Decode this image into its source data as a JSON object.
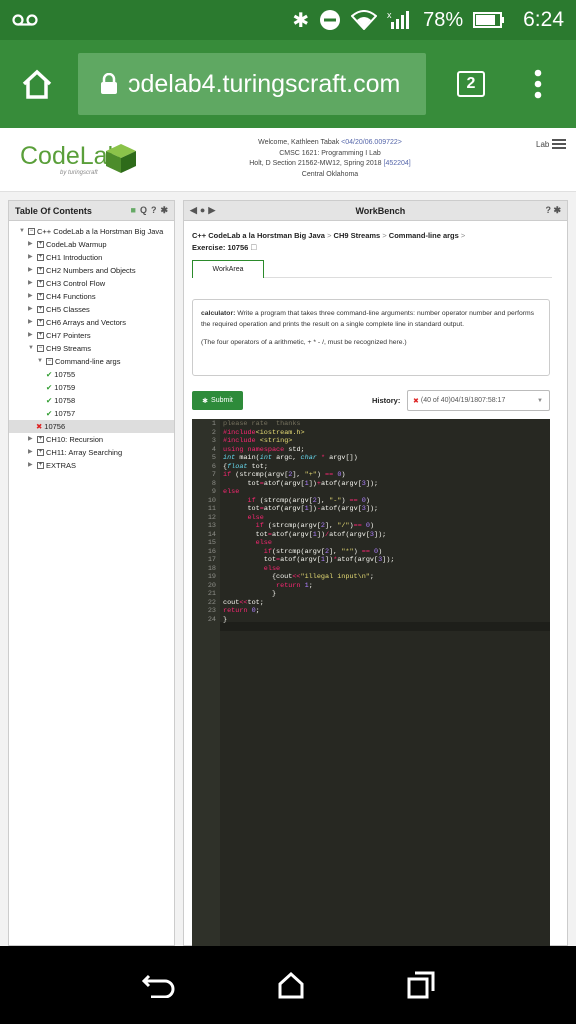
{
  "status": {
    "battery": "78%",
    "time": "6:24"
  },
  "browser": {
    "url": "ɔdelab4.turingscraft.com",
    "tabs": "2"
  },
  "header": {
    "logo": "CodeLab",
    "logo_sub": "by turingscraft",
    "welcome_line1_pre": "Welcome, Kathleen Tabak ",
    "welcome_line1_id": "<04/20/06.009722>",
    "welcome_line2": "CMSC 1621: Programming I Lab",
    "welcome_line3_pre": "Holt, D  Section 21562-MW12, Spring 2018  ",
    "welcome_line3_id": "[452204]",
    "welcome_line4": "Central Oklahoma",
    "lab": "Lab"
  },
  "toc": {
    "title": "Table Of Contents",
    "items": [
      {
        "label": "C++ CodeLab a la Horstman Big Java",
        "level": 0,
        "state": "open"
      },
      {
        "label": "CodeLab Warmup",
        "level": 1,
        "state": "closed"
      },
      {
        "label": "CH1 Introduction",
        "level": 1,
        "state": "closed"
      },
      {
        "label": "CH2 Numbers and Objects",
        "level": 1,
        "state": "closed"
      },
      {
        "label": "CH3 Control Flow",
        "level": 1,
        "state": "closed"
      },
      {
        "label": "CH4 Functions",
        "level": 1,
        "state": "closed"
      },
      {
        "label": "CH5 Classes",
        "level": 1,
        "state": "closed"
      },
      {
        "label": "CH6 Arrays and Vectors",
        "level": 1,
        "state": "closed"
      },
      {
        "label": "CH7 Pointers",
        "level": 1,
        "state": "closed"
      },
      {
        "label": "CH9 Streams",
        "level": 1,
        "state": "open"
      },
      {
        "label": "Command-line args",
        "level": 2,
        "state": "open"
      },
      {
        "label": "10755",
        "level": 3,
        "state": "ok"
      },
      {
        "label": "10759",
        "level": 3,
        "state": "ok"
      },
      {
        "label": "10758",
        "level": 3,
        "state": "ok"
      },
      {
        "label": "10757",
        "level": 3,
        "state": "ok"
      },
      {
        "label": "10756",
        "level": 3,
        "state": "x"
      },
      {
        "label": "CH10: Recursion",
        "level": 1,
        "state": "closed"
      },
      {
        "label": "CH11: Array Searching",
        "level": 1,
        "state": "closed"
      },
      {
        "label": "EXTRAS",
        "level": 1,
        "state": "closed"
      }
    ]
  },
  "workbench": {
    "title": "WorkBench",
    "crumbs": [
      "C++ CodeLab a la Horstman Big Java",
      "CH9 Streams",
      "Command-line args"
    ],
    "exercise": "Exercise: 10756",
    "tab": "WorkArea",
    "instr_bold": "calculator:",
    "instr_body": " Write a program that takes three command-line arguments: number operator number and performs the required operation and prints the result on a single complete line in standard output.",
    "instr_note": "(The four operators of a arithmetic, + * - /, must be recognized here.)",
    "submit": "Submit",
    "history_label": "History:",
    "history_value": "(40 of 40)04/19/1807:58:17"
  },
  "code_lines": [
    "1",
    "2",
    "3",
    "4",
    "5",
    "6",
    "7",
    "8",
    "9",
    "10",
    "11",
    "12",
    "13",
    "14",
    "15",
    "16",
    "17",
    "18",
    "19",
    "20",
    "21",
    "22",
    "23",
    "24"
  ]
}
